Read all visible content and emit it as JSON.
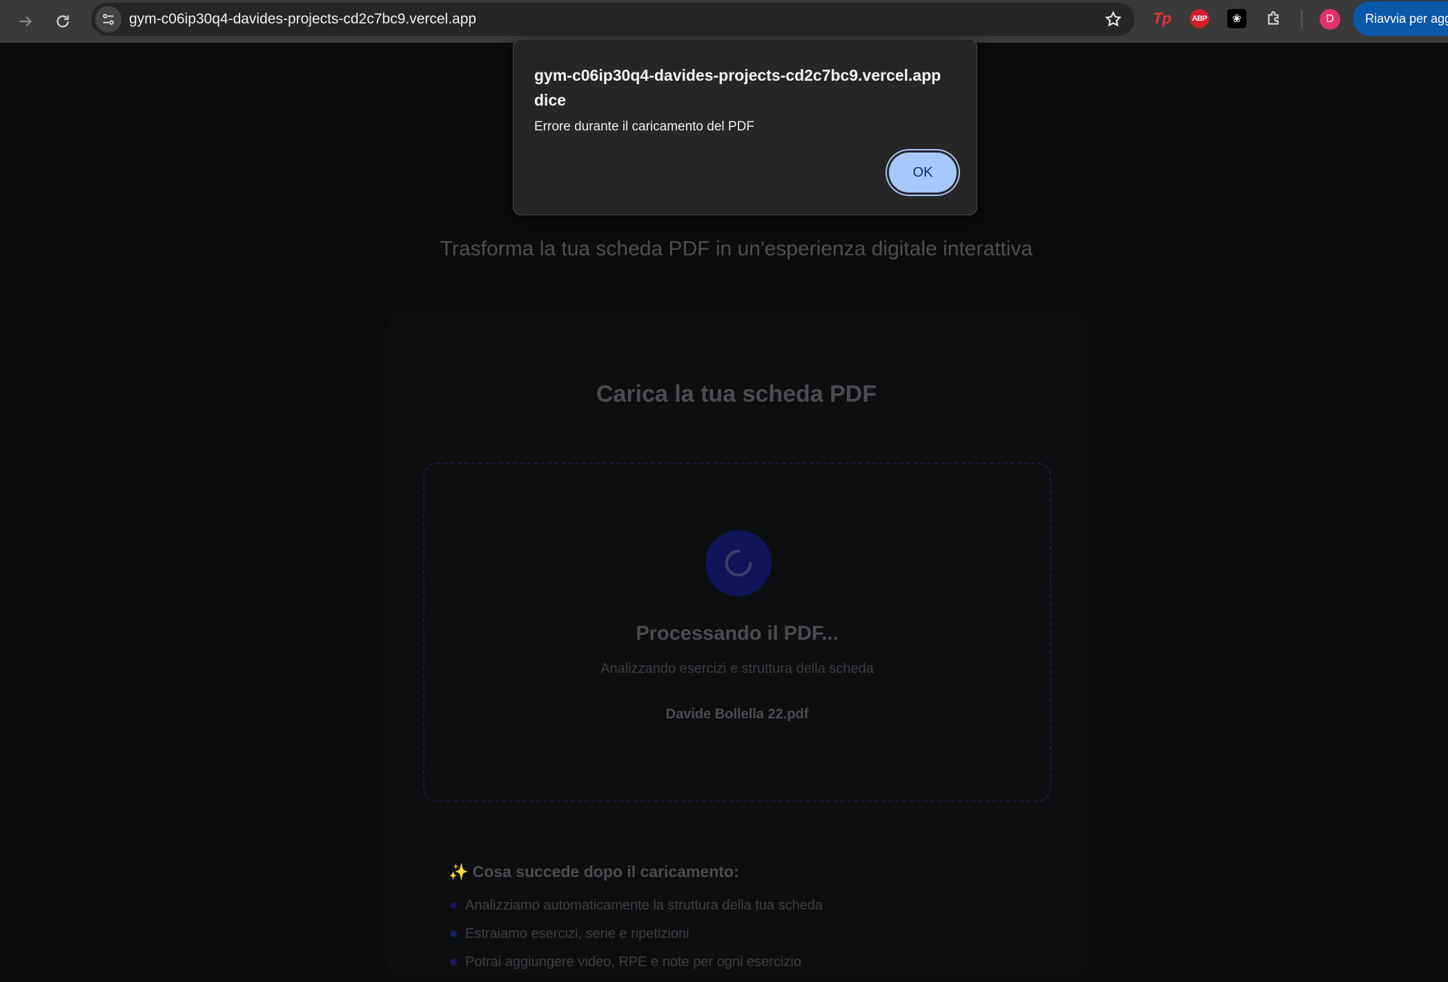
{
  "browser": {
    "url": "gym-c06ip30q4-davides-projects-cd2c7bc9.vercel.app",
    "extensions": [
      "Tp",
      "ABP",
      "chatgpt-icon",
      "puzzle-icon"
    ],
    "ext_tp": "Tp",
    "ext_abp": "ABP",
    "profile_initial": "D",
    "restart_label": "Riavvia per agg"
  },
  "page": {
    "subtitle": "Trasforma la tua scheda PDF in un'esperienza digitale interattiva",
    "card_title": "Carica la tua scheda PDF",
    "processing_title": "Processando il PDF...",
    "processing_sub": "Analizzando esercizi e struttura della scheda",
    "file_name": "Davide Bollella 22.pdf",
    "info_title": "Cosa succede dopo il caricamento:",
    "info_items": [
      {
        "text": "Analizziamo automaticamente la struttura della tua scheda",
        "dot_color": "#1c1450"
      },
      {
        "text": "Estraiamo esercizi, serie e ripetizioni",
        "dot_color": "#13225a"
      },
      {
        "text": "Potrai aggiungere video, RPE e note per ogni esercizio",
        "dot_color": "#241454"
      }
    ]
  },
  "dialog": {
    "title": "gym-c06ip30q4-davides-projects-cd2c7bc9.vercel.app dice",
    "message": "Errore durante il caricamento del PDF",
    "ok_label": "OK"
  },
  "colors": {
    "accent_button": "#a8c7fa",
    "restart_button": "#0b57a8",
    "avatar": "#e0306e"
  }
}
